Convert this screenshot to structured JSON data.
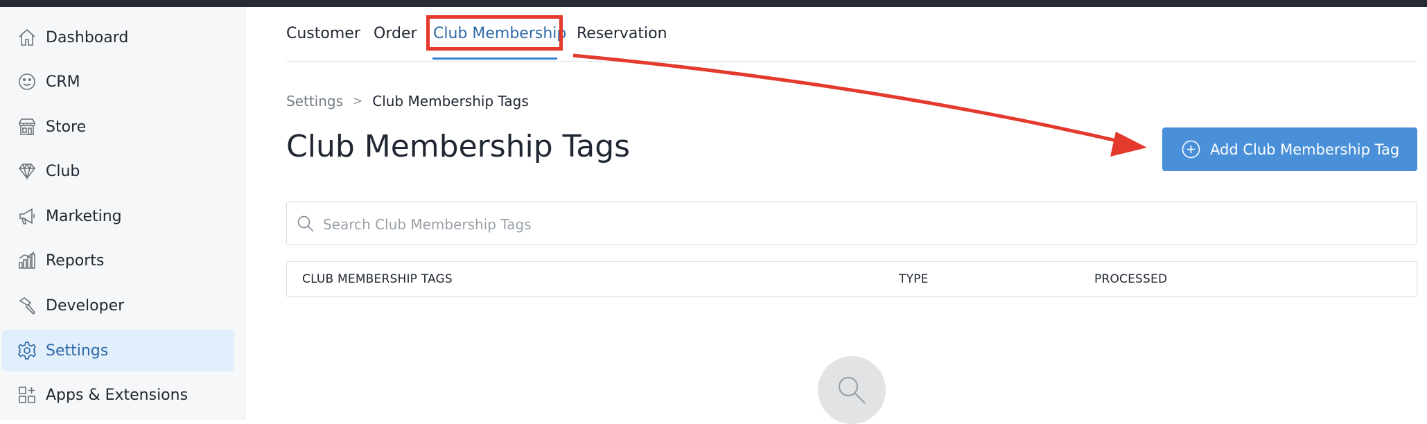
{
  "sidebar": {
    "items": [
      {
        "label": "Dashboard",
        "icon": "home-icon"
      },
      {
        "label": "CRM",
        "icon": "smiley-icon"
      },
      {
        "label": "Store",
        "icon": "store-icon"
      },
      {
        "label": "Club",
        "icon": "diamond-icon"
      },
      {
        "label": "Marketing",
        "icon": "megaphone-icon"
      },
      {
        "label": "Reports",
        "icon": "bar-chart-icon"
      },
      {
        "label": "Developer",
        "icon": "hammer-icon"
      },
      {
        "label": "Settings",
        "icon": "gear-icon",
        "active": true
      },
      {
        "label": "Apps & Extensions",
        "icon": "apps-icon"
      }
    ]
  },
  "tabs": [
    {
      "label": "Customer"
    },
    {
      "label": "Order"
    },
    {
      "label": "Club Membership",
      "active": true
    },
    {
      "label": "Reservation"
    }
  ],
  "breadcrumb": {
    "parent": "Settings",
    "separator": ">",
    "current": "Club Membership Tags"
  },
  "page": {
    "title": "Club Membership Tags",
    "add_button_label": "Add Club Membership Tag"
  },
  "search": {
    "placeholder": "Search Club Membership Tags",
    "value": ""
  },
  "table": {
    "columns": [
      "CLUB MEMBERSHIP TAGS",
      "TYPE",
      "PROCESSED"
    ]
  },
  "colors": {
    "accent": "#4a90d9",
    "active_text": "#2e69a8",
    "annotation": "#e4392d",
    "sidebar_active_bg": "#e1eefb"
  }
}
